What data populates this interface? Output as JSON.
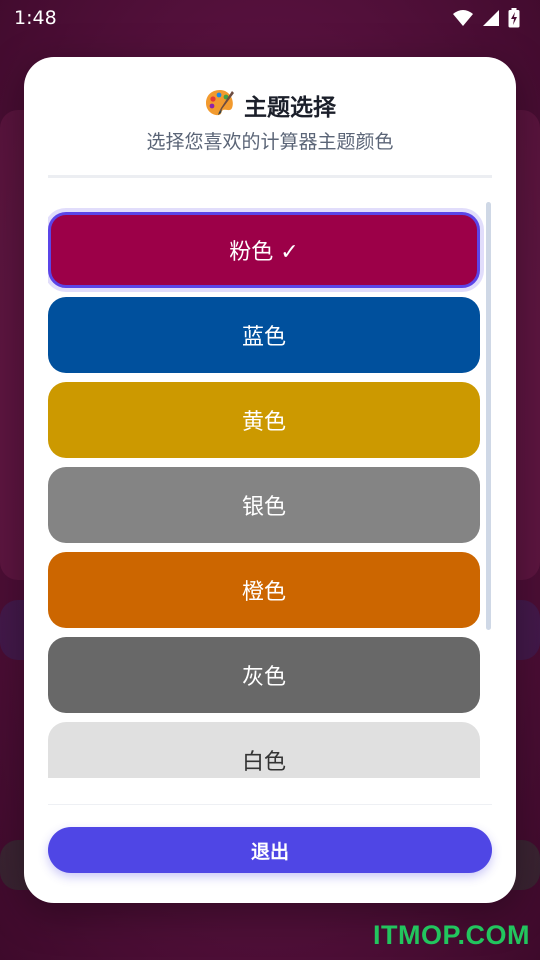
{
  "status_bar": {
    "time": "1:48",
    "icons": [
      "wifi-icon",
      "signal-icon",
      "battery-charging-icon"
    ]
  },
  "dialog": {
    "title_icon": "palette-icon",
    "title": "主题选择",
    "subtitle": "选择您喜欢的计算器主题颜色",
    "themes": [
      {
        "label": "粉色 ✓",
        "color": "#9c0048",
        "selected": true
      },
      {
        "label": "蓝色",
        "color": "#00509d",
        "selected": false
      },
      {
        "label": "黄色",
        "color": "#cc9900",
        "selected": false
      },
      {
        "label": "银色",
        "color": "#848484",
        "selected": false
      },
      {
        "label": "橙色",
        "color": "#cc6600",
        "selected": false
      },
      {
        "label": "灰色",
        "color": "#686868",
        "selected": false
      },
      {
        "label": "白色",
        "color": "#e0e0e0",
        "selected": false
      }
    ],
    "exit_label": "退出",
    "accent_color": "#4f46e5"
  },
  "watermark": "ITMOP.COM"
}
